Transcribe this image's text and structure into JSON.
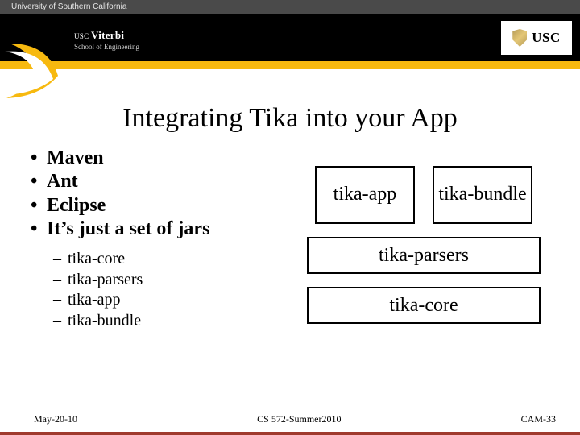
{
  "header": {
    "university": "University of Southern California",
    "usc_short": "USC",
    "viterbi_prefix": "USC",
    "viterbi_name": "Viterbi",
    "viterbi_sub": "School of Engineering"
  },
  "title": "Integrating Tika into your App",
  "bullets": {
    "main": [
      "Maven",
      "Ant",
      "Eclipse",
      "It’s just a set of jars"
    ],
    "sub": [
      "tika-core",
      "tika-parsers",
      "tika-app",
      "tika-bundle"
    ]
  },
  "diagram": {
    "top_left": "tika-app",
    "top_right": "tika-bundle",
    "mid": "tika-parsers",
    "bottom": "tika-core"
  },
  "footer": {
    "left": "May-20-10",
    "center": "CS 572-Summer2010",
    "right": "CAM-33"
  }
}
